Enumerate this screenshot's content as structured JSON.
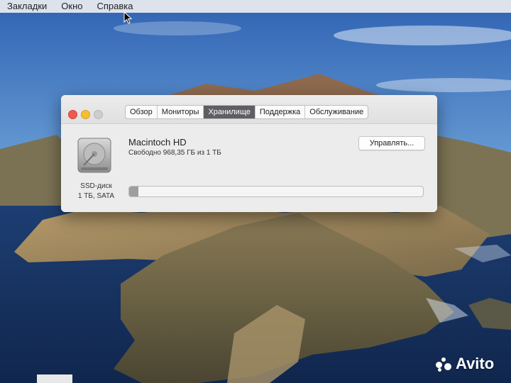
{
  "menubar": {
    "items": [
      "Закладки",
      "Окно",
      "Справка"
    ]
  },
  "window": {
    "tabs": [
      {
        "label": "Обзор",
        "active": false
      },
      {
        "label": "Мониторы",
        "active": false
      },
      {
        "label": "Хранилище",
        "active": true
      },
      {
        "label": "Поддержка",
        "active": false
      },
      {
        "label": "Обслуживание",
        "active": false
      }
    ],
    "disk": {
      "name": "Macintoch  HD",
      "free_space": "Свободно 968,35 ГБ из 1 ТБ",
      "type": "SSD-диск",
      "size": "1 ТБ, SATA",
      "icon": "hard-drive-icon",
      "used_fraction": 0.032
    },
    "manage_button": "Управлять..."
  },
  "watermark": {
    "text": "Avito"
  },
  "colors": {
    "close": "#ee5a52",
    "minimize": "#f5be33",
    "active_tab": "#5f5f63"
  }
}
